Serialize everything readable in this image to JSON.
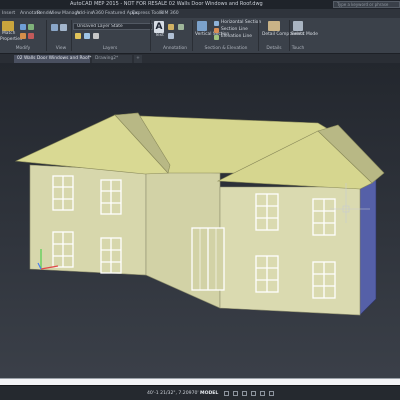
{
  "app": {
    "title": "AutoCAD MEP 2015 - NOT FOR RESALE  02 Walls Door Windows and Roof.dwg",
    "search_placeholder": "Type a keyword or phrase"
  },
  "ribbon_tabs": [
    "Insert",
    "Annotate",
    "Render",
    "View",
    "Manage",
    "Add-ins",
    "A360",
    "Featured Apps",
    "Express Tools",
    "BIM 360"
  ],
  "ribbon": {
    "match_label": "Match",
    "properties_label": "Properties",
    "modify_label": "Modify",
    "view_label": "View",
    "layer_state": "Unsaved Layer State",
    "layers_label": "Layers",
    "text_label": "Text",
    "annotation_label": "Annotation",
    "vertical_section_label": "Vertical Section",
    "horizontal_section_label": "Horizontal Section",
    "section_line_label": "Section Line",
    "elevation_line_label": "Elevation Line",
    "section_elevation_label": "Section & Elevation",
    "detail_components_label": "Detail Components",
    "details_label": "Details",
    "select_mode_label": "Select Mode",
    "touch_label": "Touch"
  },
  "doc_tabs": [
    {
      "label": "02 Walls Door Windows and Roof*",
      "active": true
    },
    {
      "label": "Drawing2*",
      "active": false
    }
  ],
  "status": {
    "coords": "40'-1 21/32\", 7.20970'",
    "model_label": "MODEL"
  },
  "colors": {
    "wall_face": "#d7d7ac",
    "wall_side": "#5560a8",
    "roof": "#d6d68f",
    "roof_shadow": "#b8b885",
    "viewport_bg": "#2b3038"
  }
}
